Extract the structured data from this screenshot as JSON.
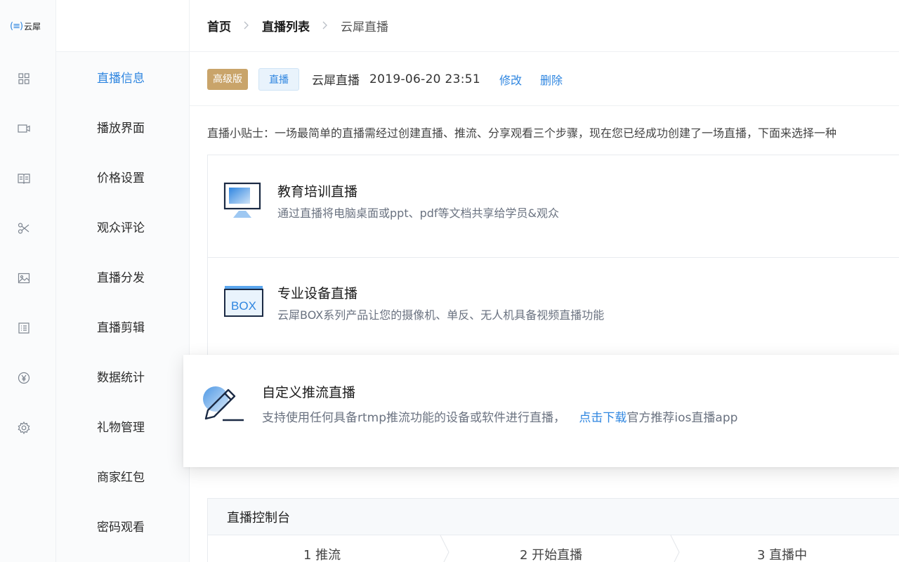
{
  "app": {
    "logo_text": "云犀",
    "logo_mark": "(≡)"
  },
  "rail_icons": [
    "grid-icon",
    "video-icon",
    "book-icon",
    "scissors-icon",
    "image-icon",
    "list-icon",
    "yen-icon",
    "gear-icon"
  ],
  "submenu": {
    "items": [
      {
        "label": "直播信息",
        "active": true
      },
      {
        "label": "播放界面"
      },
      {
        "label": "价格设置"
      },
      {
        "label": "观众评论"
      },
      {
        "label": "直播分发"
      },
      {
        "label": "直播剪辑"
      },
      {
        "label": "数据统计"
      },
      {
        "label": "礼物管理"
      },
      {
        "label": "商家红包"
      },
      {
        "label": "密码观看"
      }
    ]
  },
  "breadcrumb": {
    "home": "首页",
    "list": "直播列表",
    "current": "云犀直播",
    "separator": ">"
  },
  "info": {
    "badge_tier": "高级版",
    "badge_type": "直播",
    "name": "云犀直播",
    "datetime": "2019-06-20 23:51",
    "edit_label": "修改",
    "delete_label": "删除"
  },
  "tip": "直播小贴士：一场最简单的直播需经过创建直播、推流、分享观看三个步骤，现在您已经成功创建了一场直播，下面来选择一种",
  "cards": [
    {
      "title": "教育培训直播",
      "desc": "通过直播将电脑桌面或ppt、pdf等文档共享给学员&观众",
      "icon": "monitor-icon"
    },
    {
      "title": "专业设备直播",
      "desc": "云犀BOX系列产品让您的摄像机、单反、无人机具备视频直播功能",
      "icon": "box-icon",
      "icon_text": "BOX"
    },
    {
      "title": "自定义推流直播",
      "desc": "支持使用任何具备rtmp推流功能的设备或软件进行直播，",
      "link": "点击下载",
      "desc_suffix": "官方推荐ios直播app",
      "icon": "pen-icon"
    }
  ],
  "console": {
    "title": "直播控制台",
    "steps": [
      "1 推流",
      "2 开始直播",
      "3 直播中"
    ]
  },
  "colors": {
    "accent": "#2f86e0",
    "gold": "#c9a46a",
    "muted": "#6a7280"
  }
}
